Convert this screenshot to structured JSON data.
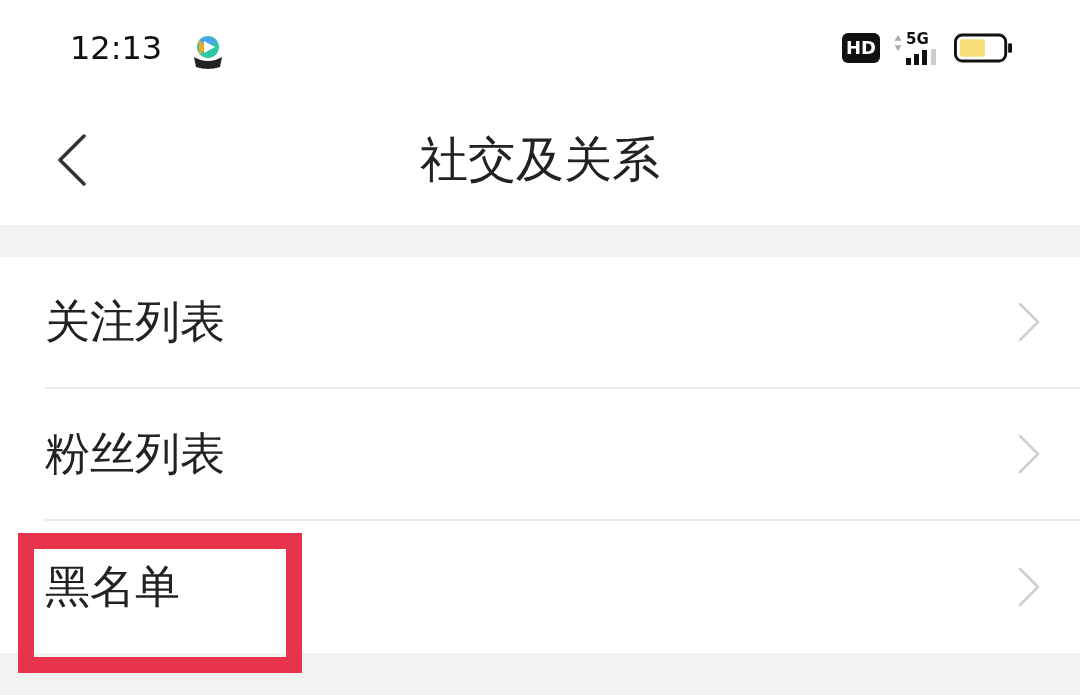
{
  "status_bar": {
    "time": "12:13",
    "network_badge": "HD",
    "network_type": "5G"
  },
  "nav_bar": {
    "title": "社交及关系"
  },
  "menu": {
    "items": [
      {
        "label": "关注列表",
        "highlighted": false
      },
      {
        "label": "粉丝列表",
        "highlighted": false
      },
      {
        "label": "黑名单",
        "highlighted": true
      }
    ]
  }
}
